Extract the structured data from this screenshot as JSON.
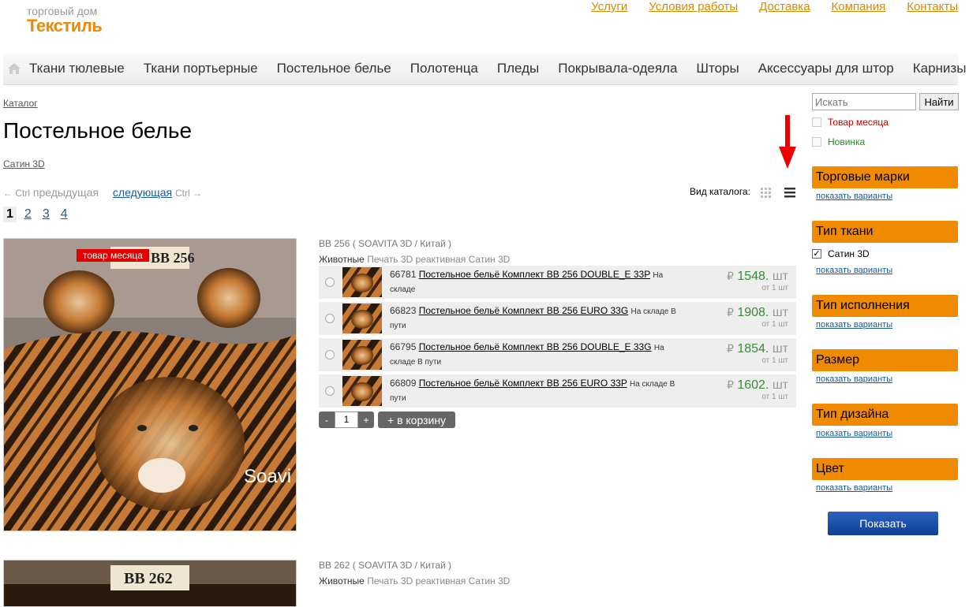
{
  "logo": {
    "line1": "торговый дом",
    "line2": "Текстиль"
  },
  "toplinks": [
    "Услуги",
    "Условия работы",
    "Доставка",
    "Компания",
    "Контакты"
  ],
  "nav": [
    "Ткани тюлевые",
    "Ткани портьерные",
    "Постельное белье",
    "Полотенца",
    "Пледы",
    "Покрывала-одеяла",
    "Шторы",
    "Аксессуары для штор",
    "Карнизы"
  ],
  "breadcrumb": "Каталог",
  "title": "Постельное белье",
  "subcategory": "Сатин 3D",
  "prev": {
    "label": "предыдущая",
    "hint": "← Ctrl"
  },
  "next": {
    "label": "следующая",
    "hint": "Ctrl →"
  },
  "pages": [
    "1",
    "2",
    "3",
    "4"
  ],
  "view_label": "Вид каталога:",
  "product1": {
    "badge": "товар месяца",
    "card_code": "BB 256",
    "brand_text": "Soavi",
    "head": "BB 256 ( SOAVITA 3D / Китай )",
    "tag1": "Животные",
    "tags": "Печать 3D реактивная Сатин 3D",
    "rows": [
      {
        "code": "66781",
        "name": "Постельное бельё Комплект BB 256 DOUBLE_E 33P",
        "stock": "На складе",
        "price": "1548.",
        "unit": "шт",
        "min": "от 1 шт"
      },
      {
        "code": "66823",
        "name": "Постельное бельё Комплект BB 256 EURO 33G",
        "stock": "На складе В пути",
        "price": "1908.",
        "unit": "шт",
        "min": "от 1 шт"
      },
      {
        "code": "66795",
        "name": "Постельное бельё Комплект BB 256 DOUBLE_E 33G",
        "stock": "На складе В пути",
        "price": "1854.",
        "unit": "шт",
        "min": "от 1 шт"
      },
      {
        "code": "66809",
        "name": "Постельное бельё Комплект BB 256 EURO 33P",
        "stock": "На складе В пути",
        "price": "1602.",
        "unit": "шт",
        "min": "от 1 шт"
      }
    ]
  },
  "currency": "₽",
  "qty": {
    "minus": "-",
    "value": "1",
    "plus": "+",
    "cart": "+ в корзину"
  },
  "product2": {
    "card_code": "BB 262",
    "head": "BB 262 ( SOAVITA 3D / Китай )",
    "tag1": "Животные",
    "tags": "Печать 3D реактивная Сатин 3D"
  },
  "search": {
    "placeholder": "Искать",
    "button": "Найти"
  },
  "filters": {
    "month": "Товар месяца",
    "new": "Новинка"
  },
  "facets": [
    {
      "title": "Торговые марки",
      "show": "показать варианты"
    },
    {
      "title": "Тип ткани",
      "checked": "Сатин 3D",
      "show": "показать варианты"
    },
    {
      "title": "Тип исполнения",
      "show": "показать варианты"
    },
    {
      "title": "Размер",
      "show": "показать варианты"
    },
    {
      "title": "Тип дизайна",
      "show": "показать варианты"
    },
    {
      "title": "Цвет",
      "show": "показать варианты"
    }
  ],
  "show_button": "Показать",
  "colors": {
    "accent": "#f08a00",
    "price": "#3a8a3a",
    "link": "#1a5a9a",
    "badge": "#e00000"
  }
}
